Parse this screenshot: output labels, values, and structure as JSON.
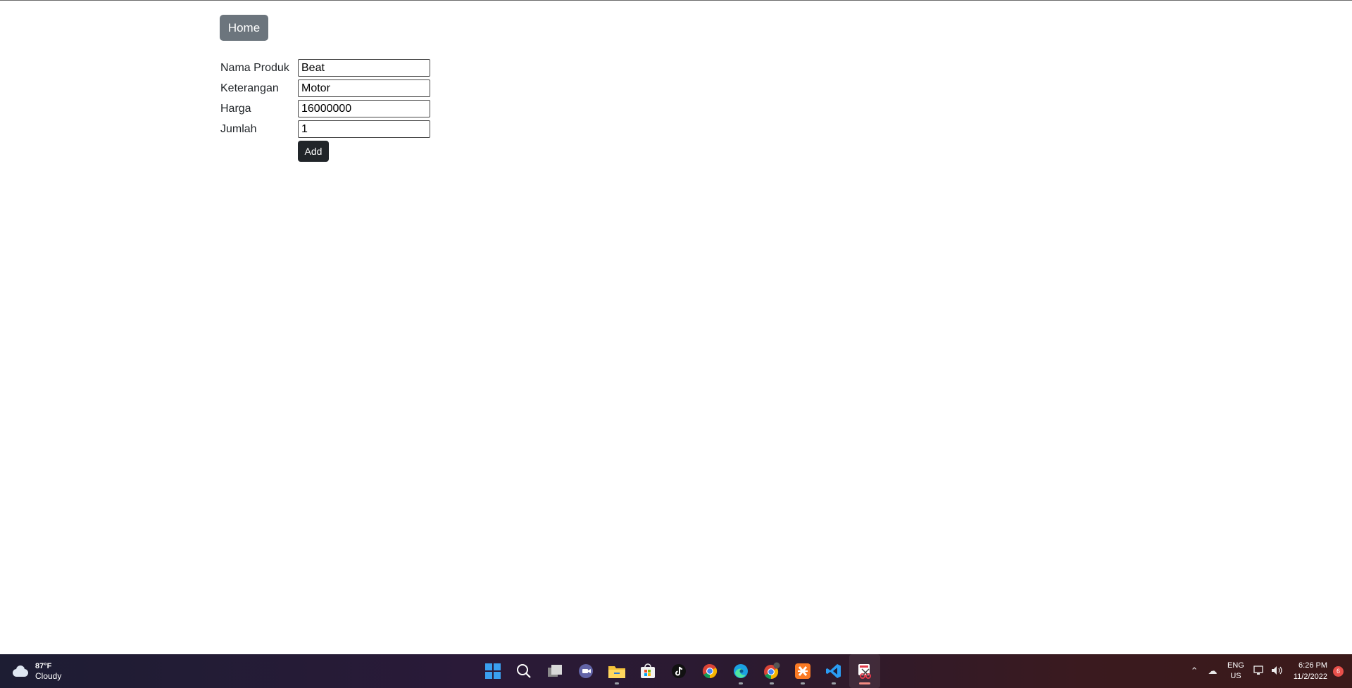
{
  "nav": {
    "home_label": "Home"
  },
  "form": {
    "fields": [
      {
        "label": "Nama Produk",
        "value": "Beat"
      },
      {
        "label": "Keterangan",
        "value": "Motor"
      },
      {
        "label": "Harga",
        "value": "16000000"
      },
      {
        "label": "Jumlah",
        "value": "1"
      }
    ],
    "submit_label": "Add"
  },
  "taskbar": {
    "weather": {
      "temp": "87°F",
      "condition": "Cloudy"
    },
    "apps": [
      "windows-start-icon",
      "search-icon",
      "task-view-icon",
      "teams-chat-icon",
      "file-explorer-icon",
      "microsoft-store-icon",
      "tiktok-icon",
      "chrome-icon",
      "edge-icon",
      "chrome-profile-icon",
      "xampp-icon",
      "vscode-icon",
      "snipping-tool-icon"
    ],
    "tray": {
      "language": "ENG",
      "region": "US",
      "time": "6:26 PM",
      "date": "11/2/2022",
      "notification_count": "6"
    }
  }
}
